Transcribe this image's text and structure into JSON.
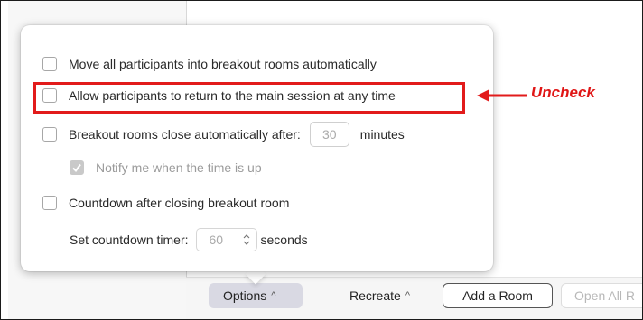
{
  "popover": {
    "options": [
      {
        "label": "Move all participants into breakout rooms automatically",
        "checked": false
      },
      {
        "label": "Allow participants to return to the main session at any time",
        "checked": false
      },
      {
        "label_before": "Breakout rooms close automatically after:",
        "value": "30",
        "label_after": "minutes",
        "checked": false
      },
      {
        "label": "Notify me when the time is up",
        "checked": true,
        "disabled": true
      },
      {
        "label": "Countdown after closing breakout room",
        "checked": false
      }
    ],
    "countdown": {
      "label": "Set countdown timer:",
      "value": "60",
      "unit": "seconds"
    }
  },
  "annotation": {
    "text": "Uncheck",
    "color": "#e01616"
  },
  "toolbar": {
    "options_label": "Options",
    "options_caret": "^",
    "recreate_label": "Recreate",
    "recreate_caret": "^",
    "add_room_label": "Add a Room",
    "open_all_label": "Open All R"
  }
}
